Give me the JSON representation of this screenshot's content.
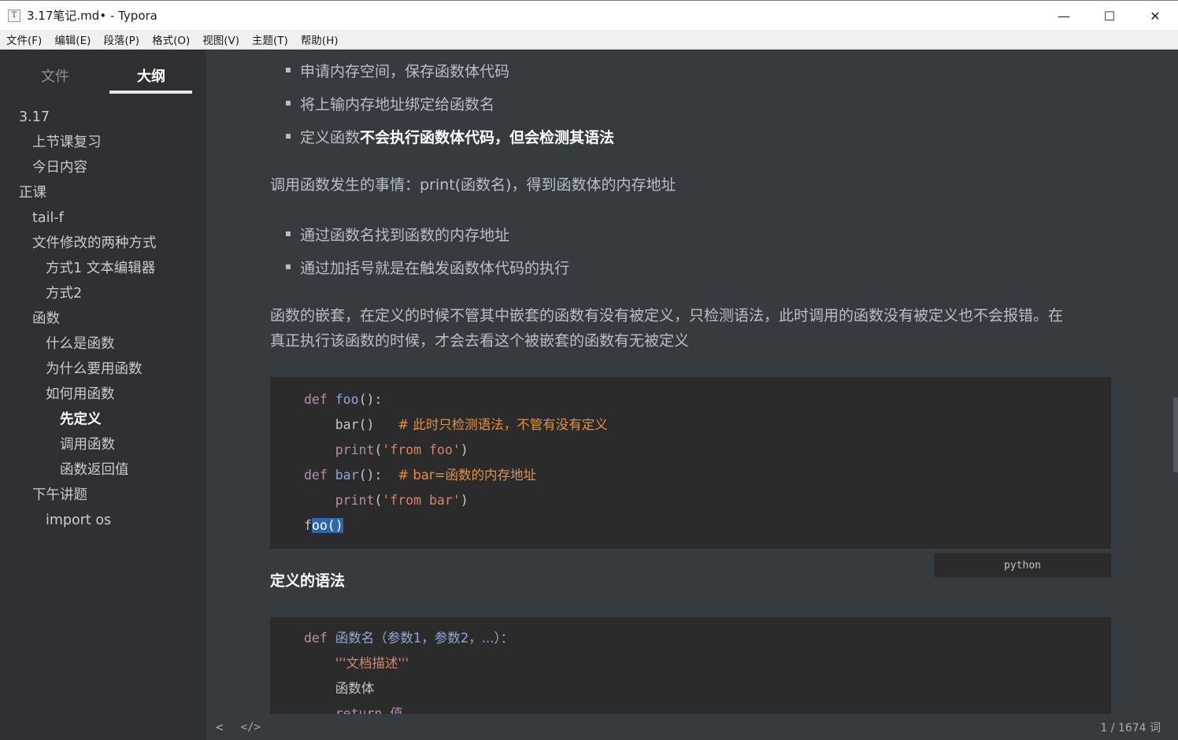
{
  "window": {
    "icon_glyph": "T",
    "title": "3.17笔记.md• - Typora",
    "minimize": "—",
    "maximize": "☐",
    "close": "✕"
  },
  "menu": [
    "文件(F)",
    "编辑(E)",
    "段落(P)",
    "格式(O)",
    "视图(V)",
    "主题(T)",
    "帮助(H)"
  ],
  "sidebar": {
    "tabs": [
      "文件",
      "大纲"
    ],
    "active_tab": "大纲",
    "outline": [
      {
        "label": "3.17",
        "level": 1
      },
      {
        "label": "上节课复习",
        "level": 2
      },
      {
        "label": "今日内容",
        "level": 2
      },
      {
        "label": "正课",
        "level": 1
      },
      {
        "label": "tail-f",
        "level": 2
      },
      {
        "label": "文件修改的两种方式",
        "level": 2
      },
      {
        "label": "方式1 文本编辑器",
        "level": 3
      },
      {
        "label": "方式2",
        "level": 3
      },
      {
        "label": "函数",
        "level": 2
      },
      {
        "label": "什么是函数",
        "level": 3
      },
      {
        "label": "为什么要用函数",
        "level": 3
      },
      {
        "label": "如何用函数",
        "level": 3
      },
      {
        "label": "先定义",
        "level": 4,
        "active": true
      },
      {
        "label": "调用函数",
        "level": 4
      },
      {
        "label": "函数返回值",
        "level": 4
      },
      {
        "label": "下午讲题",
        "level": 2
      },
      {
        "label": "import os",
        "level": 3
      }
    ]
  },
  "content": {
    "bullets_a": [
      "申请内存空间，保存函数体代码",
      "将上输内存地址绑定给函数名"
    ],
    "bullet_a3_prefix": "定义函数",
    "bullet_a3_bold": "不会执行函数体代码，但会检测其语法",
    "para_call": "调用函数发生的事情：print(函数名)，得到函数体的内存地址",
    "bullets_b": [
      "通过函数名找到函数的内存地址",
      "通过加括号就是在触发函数体代码的执行"
    ],
    "para_nested_1": "函数的嵌套，在定义的时候不管其中嵌套的函数有没有被定义，只检测语法，此时调用的函数没有被定义也不会报错。在",
    "para_nested_2": "真正执行该函数的时候，才会去看这个被嵌套的函数有无被定义",
    "code1": {
      "l1_kw": "def",
      "l1_fn": "foo",
      "l1_rest": "():",
      "l2_call": "bar()",
      "l2_cm": "# 此时只检测语法，不管有没有定义",
      "l3_fn": "print",
      "l3_open": "(",
      "l3_str": "'from foo'",
      "l3_close": ")",
      "l4_kw": "def",
      "l4_fn": "bar",
      "l4_rest": "():",
      "l4_cm": "# bar=函数的内存地址",
      "l5_fn": "print",
      "l5_open": "(",
      "l5_str": "'from bar'",
      "l5_close": ")",
      "l6_plain": "f",
      "l6_sel": "oo()"
    },
    "lang": "python",
    "heading": "定义的语法",
    "code2": {
      "l1_kw": "def",
      "l1_rest": "函数名（参数1，参数2，...）：",
      "l2_str": "'''文档描述'''",
      "l3": "函数体",
      "l4": "return 值"
    }
  },
  "footer": {
    "back_icon": "<",
    "source_icon": "</>",
    "word_count": "1 / 1674 词"
  },
  "colors": {
    "sidebar_bg": "#2e3033",
    "content_bg": "#363b40",
    "code_bg": "#2b2b2b",
    "keyword": "#b48ead",
    "comment": "#e0904a",
    "string": "#d08770",
    "selection": "#2e67b0"
  }
}
